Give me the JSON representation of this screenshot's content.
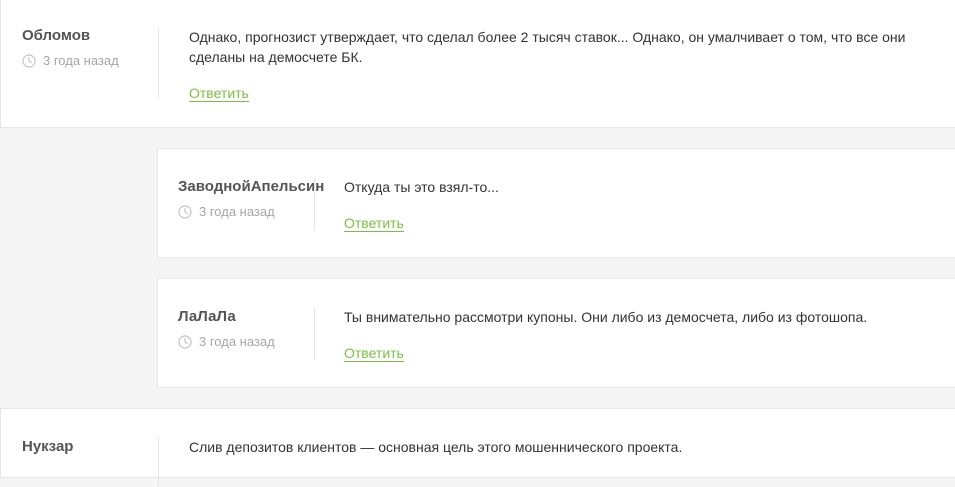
{
  "comments": [
    {
      "author": "Обломов",
      "time": "3 года назад",
      "text": "Однако, прогнозист утверждает, что сделал более 2 тысяч ставок... Однако, он умалчивает о том, что все они сделаны на демосчете БК.",
      "reply_label": "Ответить"
    },
    {
      "author": "ЗаводнойАпельсин",
      "time": "3 года назад",
      "text": "Откуда ты это взял-то...",
      "reply_label": "Ответить"
    },
    {
      "author": "ЛаЛаЛа",
      "time": "3 года назад",
      "text": "Ты внимательно рассмотри купоны. Они либо из демосчета, либо из фотошопа.",
      "reply_label": "Ответить"
    },
    {
      "author": "Нукзар",
      "text": "Слив депозитов клиентов — основная цель этого мошеннического проекта."
    }
  ],
  "colors": {
    "accent": "#7bbf42",
    "muted": "#a6a6a6",
    "border": "#e6e6e6"
  },
  "icons": {
    "time": "clock-icon"
  }
}
